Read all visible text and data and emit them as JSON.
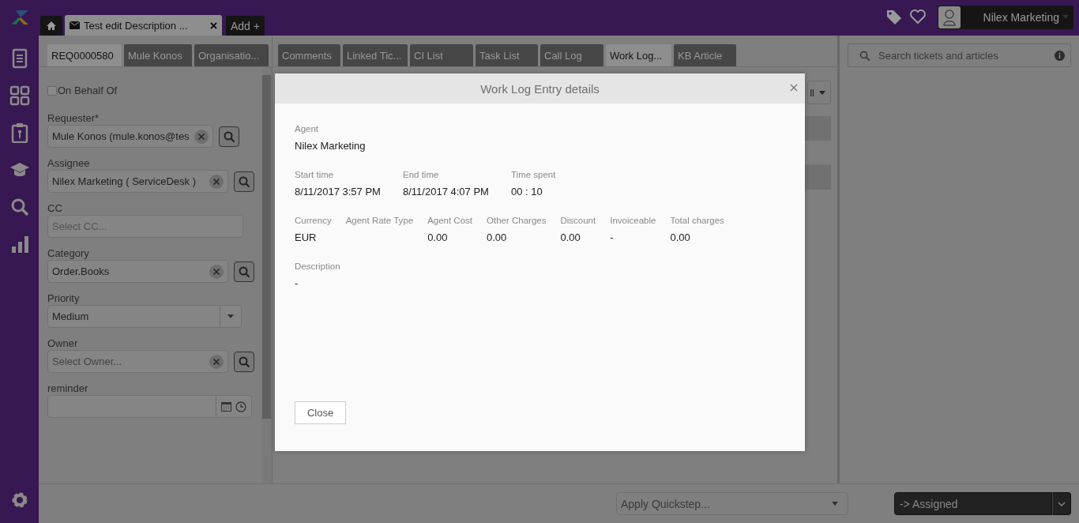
{
  "header": {
    "user_name": "Nilex Marketing"
  },
  "doc_tabs": [
    {
      "label": "Test edit Description ...",
      "selected": true
    }
  ],
  "add_button": {
    "label": "Add +"
  },
  "record_tabs": [
    {
      "label": "REQ0000580",
      "selected": true
    },
    {
      "label": "Mule Konos",
      "selected": false
    },
    {
      "label": "Organisatio...",
      "selected": false
    }
  ],
  "detail_tabs": [
    {
      "label": "Comments",
      "selected": false
    },
    {
      "label": "Linked Tic...",
      "selected": false
    },
    {
      "label": "CI List",
      "selected": false
    },
    {
      "label": "Task List",
      "selected": false
    },
    {
      "label": "Call Log",
      "selected": false
    },
    {
      "label": "Work Log...",
      "selected": true
    },
    {
      "label": "KB Article",
      "selected": false
    }
  ],
  "form": {
    "on_behalf_of": {
      "label": "On Behalf Of",
      "checked": false
    },
    "fields": [
      {
        "kind": "lookup",
        "label": "Requester*",
        "value": "Mule Konos (mule.konos@tes"
      },
      {
        "kind": "lookup",
        "label": "Assignee",
        "value": "Nilex Marketing ( ServiceDesk )"
      },
      {
        "kind": "multi",
        "label": "CC",
        "placeholder": "Select CC..."
      },
      {
        "kind": "lookup",
        "label": "Category",
        "value": "Order.Books"
      },
      {
        "kind": "select",
        "label": "Priority",
        "value": "Medium"
      },
      {
        "kind": "lookup",
        "label": "Owner",
        "placeholder": "Select Owner..."
      },
      {
        "kind": "datetime",
        "label": "reminder"
      }
    ]
  },
  "worklog_filter": {
    "value": "ll"
  },
  "search": {
    "placeholder": "Search tickets and articles"
  },
  "quickstep": {
    "placeholder": "Apply Quickstep..."
  },
  "status_button": {
    "label": "-> Assigned"
  },
  "modal": {
    "title": "Work Log Entry details",
    "sections": [
      [
        {
          "label": "Agent",
          "value": "Nilex Marketing"
        }
      ],
      [
        {
          "label": "Start time",
          "value": "8/11/2017 3:57 PM"
        },
        {
          "label": "End time",
          "value": "8/11/2017 4:07 PM"
        },
        {
          "label": "Time spent",
          "value": "00 : 10"
        }
      ],
      [
        {
          "label": "Currency",
          "value": "EUR"
        },
        {
          "label": "Agent Rate Type"
        },
        {
          "label": "Agent Cost",
          "value": "0.00"
        },
        {
          "label": "Other Charges",
          "value": "0.00"
        },
        {
          "label": "Discount",
          "value": "0.00"
        },
        {
          "label": "Invoiceable",
          "value": "-"
        },
        {
          "label": "Total charges",
          "value": "0.00"
        }
      ],
      [
        {
          "label": "Description",
          "value": "-"
        }
      ]
    ],
    "close_button": {
      "label": "Close"
    }
  }
}
